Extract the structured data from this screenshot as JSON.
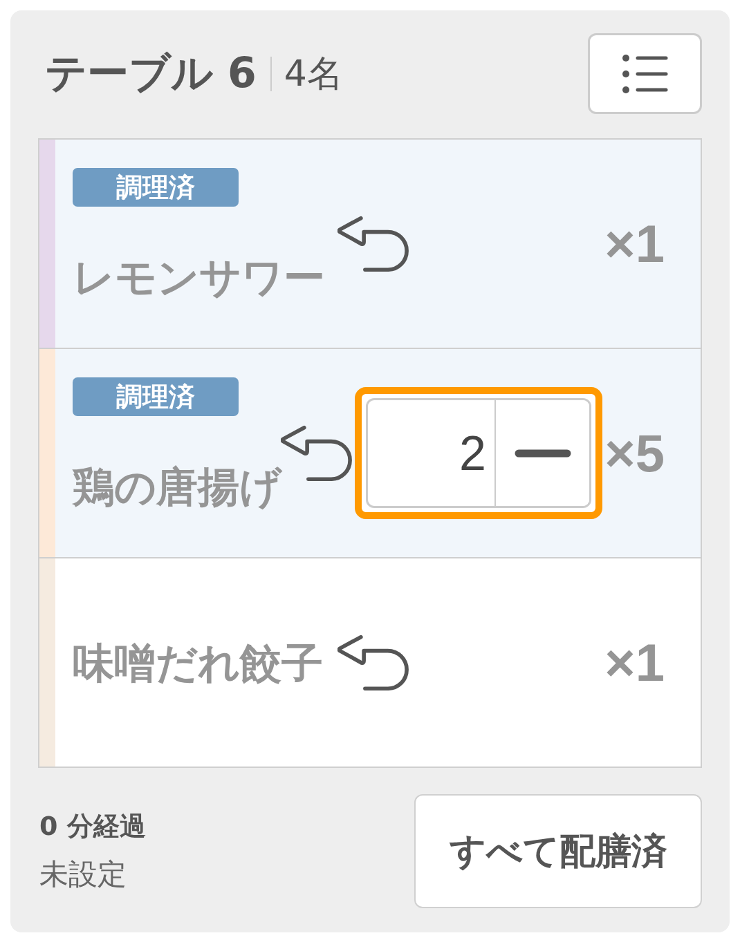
{
  "header": {
    "title": "テーブル 6",
    "guests": "4名"
  },
  "items": [
    {
      "badge": "調理済",
      "name": "レモンサワー",
      "quantity": "×1",
      "color": "#e6d8ec",
      "cooked": true,
      "served": true
    },
    {
      "badge": "調理済",
      "name": "鶏の唐揚げ",
      "quantity": "×5",
      "color": "#fde9d8",
      "cooked": true,
      "served": true,
      "stepper": {
        "value": "2",
        "focused": true
      }
    },
    {
      "name": "味噌だれ餃子",
      "quantity": "×1",
      "color": "#f5ebe0",
      "cooked": false,
      "served": true
    }
  ],
  "footer": {
    "elapsed": "0 分経過",
    "timer": "未設定",
    "button": "すべて配膳済"
  }
}
